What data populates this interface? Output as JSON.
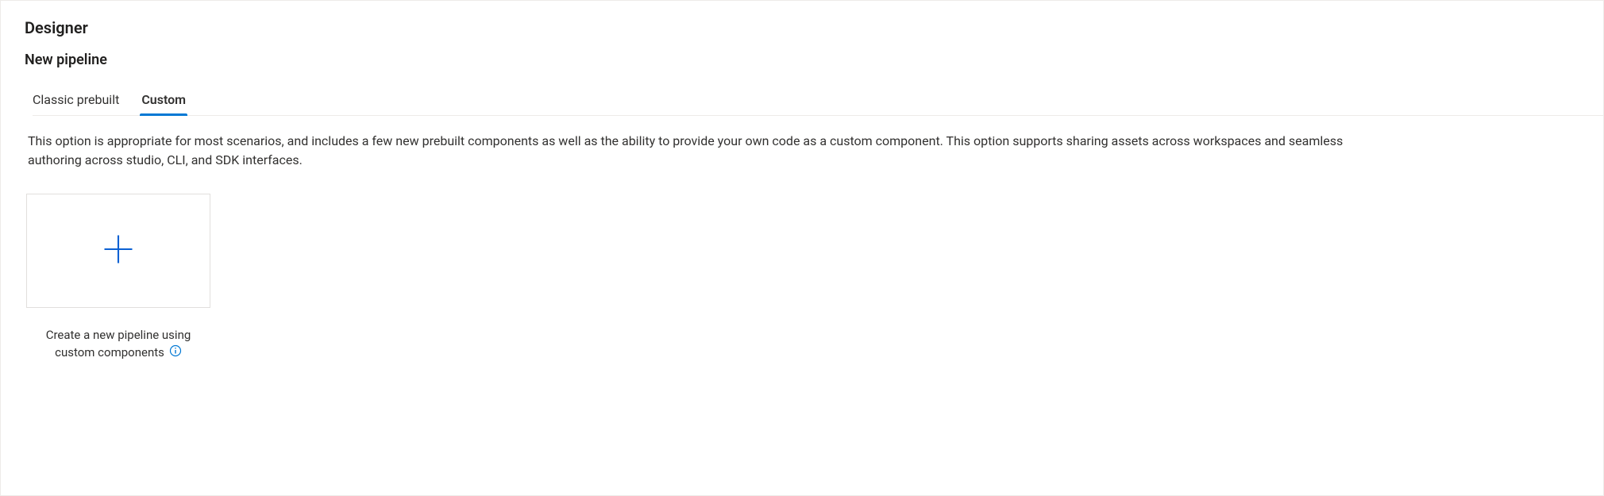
{
  "header": {
    "title": "Designer",
    "subtitle": "New pipeline"
  },
  "tabs": [
    {
      "label": "Classic prebuilt",
      "active": false
    },
    {
      "label": "Custom",
      "active": true
    }
  ],
  "description": "This option is appropriate for most scenarios, and includes a few new prebuilt components as well as the ability to provide your own code as a custom component. This option supports sharing assets across workspaces and seamless authoring across studio, CLI, and SDK interfaces.",
  "card": {
    "caption_line1": "Create a new pipeline using",
    "caption_line2": "custom components"
  }
}
